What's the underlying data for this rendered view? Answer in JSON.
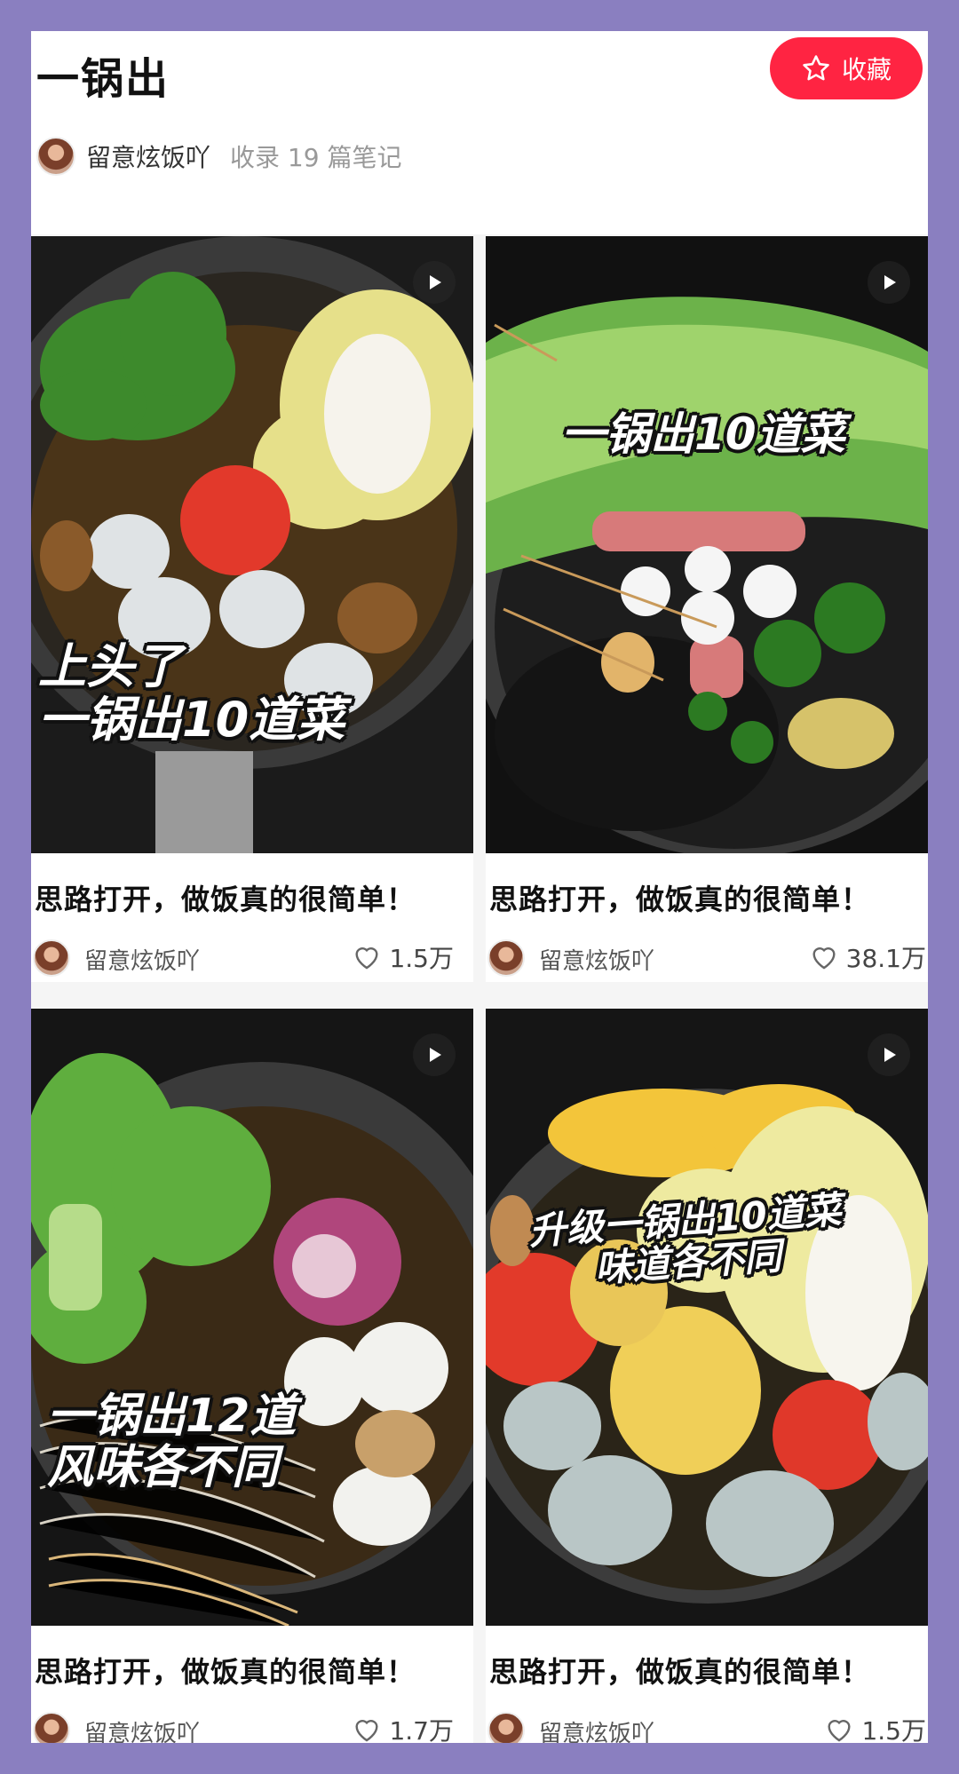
{
  "header": {
    "title": "一锅出",
    "collect_label": "收藏",
    "author_name": "留意炫饭吖",
    "note_count": "收录 19 篇笔记"
  },
  "colors": {
    "background": "#8a7fc0",
    "accent": "#ff2442"
  },
  "cards": [
    {
      "overlay_text": "上头了\n一锅出10道菜",
      "title": "思路打开，做饭真的很简单！",
      "author": "留意炫饭吖",
      "likes": "1.5万"
    },
    {
      "overlay_text": "一锅出10道菜",
      "title": "思路打开，做饭真的很简单！",
      "author": "留意炫饭吖",
      "likes": "38.1万"
    },
    {
      "overlay_text": "一锅出12道\n风味各不同",
      "title": "思路打开，做饭真的很简单！",
      "author": "留意炫饭吖",
      "likes": "1.7万"
    },
    {
      "overlay_text": "升级一锅出10道菜\n味道各不同",
      "title": "思路打开，做饭真的很简单！",
      "author": "留意炫饭吖",
      "likes": "1.5万"
    }
  ],
  "icons": {
    "collect": "star-outline-icon",
    "play": "play-icon",
    "like": "heart-outline-icon"
  }
}
